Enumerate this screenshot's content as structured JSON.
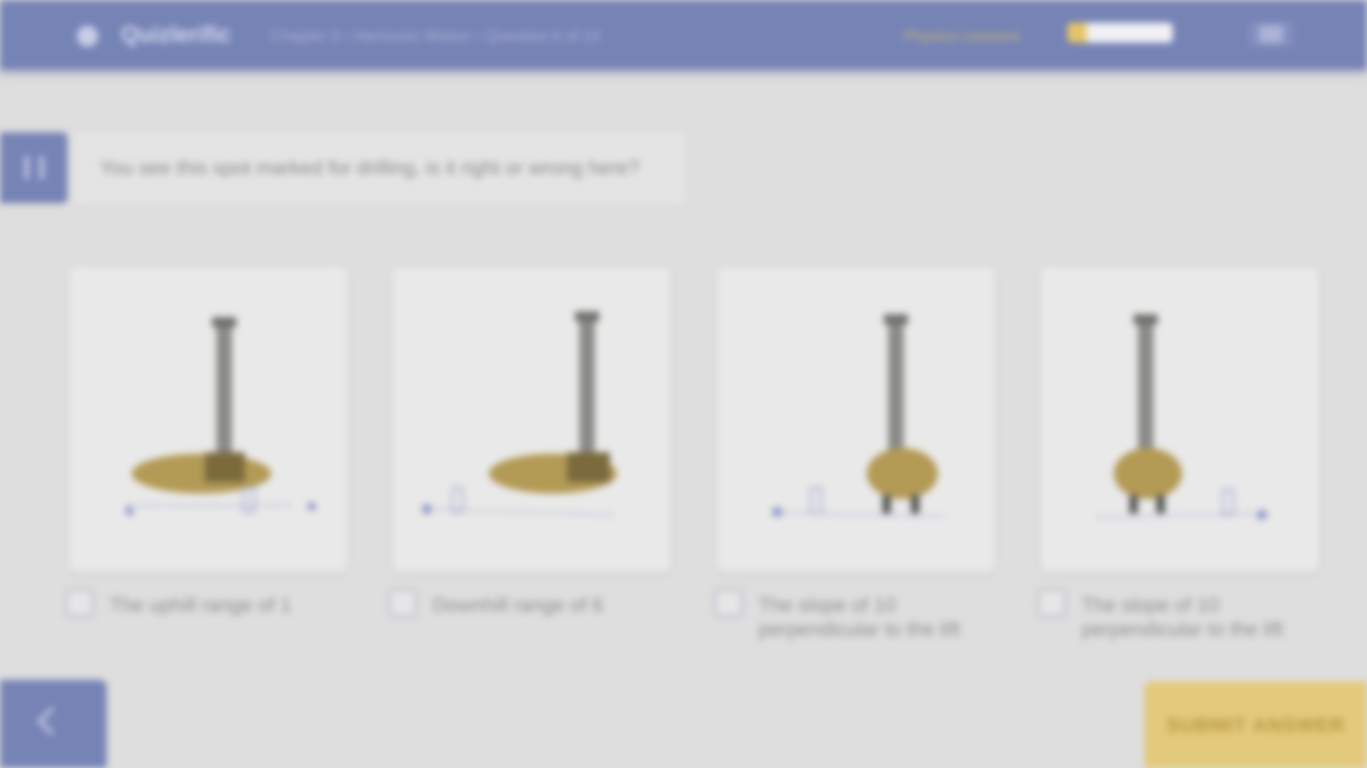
{
  "header": {
    "logo_text": "Quizlerific",
    "breadcrumb": "Chapter 3 › Harmonic Motion › Question 6 of 10",
    "points_label": "Physics Lessons",
    "progress_fraction": 0.18,
    "menu_icon": "hamburger-icon",
    "logo_icon": "logo-circle-icon"
  },
  "question": {
    "marker_icon": "pause-icon",
    "text": "You see this spot marked for drilling, is it right or wrong here?"
  },
  "options": [
    {
      "label": "The uphill range of 1"
    },
    {
      "label": "Downhill range of 6"
    },
    {
      "label": "The slope of 10 perpendicular to the lift"
    },
    {
      "label": "The slope of 10 perpendicular to the lift"
    }
  ],
  "footer": {
    "back_icon": "chevron-left-icon",
    "submit_label": "SUBMIT ANSWER"
  },
  "colors": {
    "header": "#7683b5",
    "accent_yellow": "#e2c97c",
    "background": "#dedede"
  }
}
